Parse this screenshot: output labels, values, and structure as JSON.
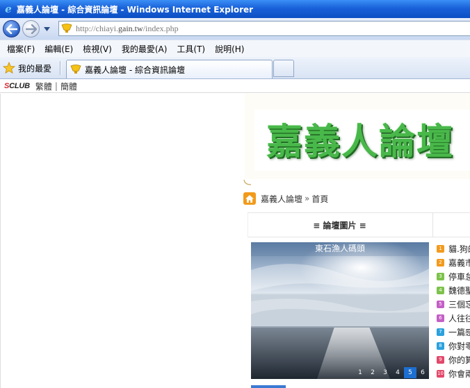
{
  "window": {
    "title": "嘉義人論壇 - 綜合資訊論壇 - Windows Internet Explorer"
  },
  "address": {
    "url_prefix": "http://chiayi.",
    "url_domain": "gain.tw",
    "url_path": "/index.php"
  },
  "menu": [
    "檔案(F)",
    "編輯(E)",
    "檢視(V)",
    "我的最愛(A)",
    "工具(T)",
    "說明(H)"
  ],
  "favorites": {
    "label": "我的最愛"
  },
  "tab": {
    "label": "嘉義人論壇 - 綜合資訊論壇"
  },
  "sitebar": {
    "logo_s": "S",
    "logo_rest": "CLUB",
    "lang_trad": "繁體",
    "lang_simp": "簡體"
  },
  "banner": {
    "logo_text": "嘉義人論壇"
  },
  "breadcrumb": {
    "site": "嘉義人論壇",
    "separator": "»",
    "page": "首頁"
  },
  "section": {
    "title": "≡ 論壇圖片 ≡"
  },
  "slideshow": {
    "caption": "東石漁人碼頭",
    "pages": [
      "1",
      "2",
      "3",
      "4",
      "5",
      "6"
    ],
    "active_page": "5"
  },
  "thread_list": [
    {
      "num": "1",
      "color": "#f39a1e",
      "text": "貓.狗的"
    },
    {
      "num": "2",
      "color": "#f39a1e",
      "text": "嘉義市"
    },
    {
      "num": "3",
      "color": "#7cc24b",
      "text": "停車怠"
    },
    {
      "num": "4",
      "color": "#7cc24b",
      "text": "魏德聖"
    },
    {
      "num": "5",
      "color": "#c45fc6",
      "text": "三個忘"
    },
    {
      "num": "6",
      "color": "#c45fc6",
      "text": "人往往"
    },
    {
      "num": "7",
      "color": "#2ba1dd",
      "text": "一篇感"
    },
    {
      "num": "8",
      "color": "#2ba1dd",
      "text": "你對零"
    },
    {
      "num": "9",
      "color": "#e2486a",
      "text": "你的算"
    },
    {
      "num": "10",
      "color": "#e2486a",
      "text": "你會兩"
    }
  ]
}
